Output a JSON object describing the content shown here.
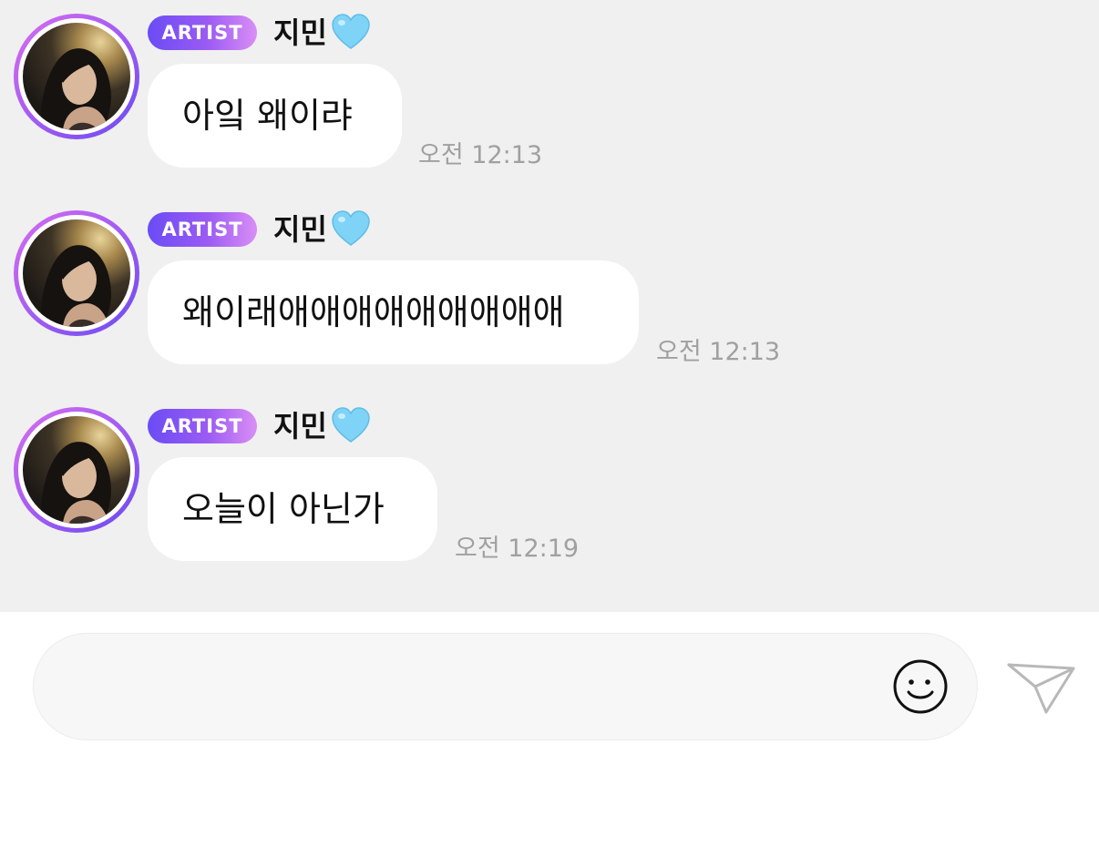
{
  "messages": [
    {
      "badge": "ARTIST",
      "sender": "지민",
      "heart": "blue-heart-emoji",
      "text": "아잌 왜이랴",
      "time": "오전 12:13"
    },
    {
      "badge": "ARTIST",
      "sender": "지민",
      "heart": "blue-heart-emoji",
      "text": "왜이래애애애애애애애애애",
      "time": "오전 12:13"
    },
    {
      "badge": "ARTIST",
      "sender": "지민",
      "heart": "blue-heart-emoji",
      "text": "오늘이 아닌가",
      "time": "오전 12:19"
    }
  ],
  "composer": {
    "emoji_icon": "smiley-icon",
    "send_icon": "paper-plane-icon"
  },
  "colors": {
    "chat_background": "#f0f0f0",
    "bubble": "#ffffff",
    "badge_gradient_start": "#6a4cf5",
    "badge_gradient_end": "#d98ef5",
    "timestamp": "#a0a0a0",
    "heart": "#7fd3f7"
  }
}
